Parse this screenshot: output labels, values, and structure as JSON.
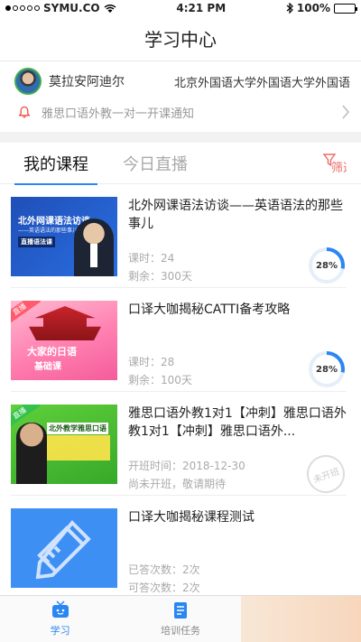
{
  "status_bar": {
    "carrier": "SYMU.CO",
    "time": "4:21 PM",
    "battery": "100%",
    "battery_level": 1.0
  },
  "nav": {
    "title": "学习中心"
  },
  "user": {
    "name": "莫拉安阿迪尔",
    "school": "北京外国语大学外国语大学外国语"
  },
  "notice": {
    "text": "雅思口语外教一对一开课通知"
  },
  "tabs": [
    {
      "label": "我的课程",
      "active": true
    },
    {
      "label": "今日直播",
      "active": false
    }
  ],
  "filter_label": "筛选",
  "courses": [
    {
      "title": "北外网课语法访谈——英语语法的那些事儿",
      "line1_label": "课时：",
      "line1_value": "24",
      "line2_label": "剩余：",
      "line2_value": "300天",
      "progress": 0.28,
      "progress_text": "28%",
      "thumb": {
        "title": "北外网课语法访谈",
        "subtitle": "——英语语法的那些事儿",
        "tag": "直播语法课"
      }
    },
    {
      "title": "口译大咖揭秘CATTI备考攻略",
      "line1_label": "课时：",
      "line1_value": "28",
      "line2_label": "剩余：",
      "line2_value": "100天",
      "progress": 0.28,
      "progress_text": "28%",
      "thumb": {
        "ribbon": "直播",
        "title": "大家的日语",
        "subtitle": "基础课"
      }
    },
    {
      "title": "雅思口语外教1对1【冲刺】雅思口语外教1对1【冲刺】雅思口语外...",
      "line1_label": "开班时间：",
      "line1_value": "2018-12-30",
      "line2_label": "",
      "line2_value": "尚未开班，敬请期待",
      "stamp": "未开班",
      "thumb": {
        "ribbon": "直播",
        "title": "北外教学雅思口语"
      }
    },
    {
      "title": "口译大咖揭秘课程测试",
      "line1_label": "已答次数：",
      "line1_value": "2次",
      "line2_label": "可答次数：",
      "line2_value": "2次"
    }
  ],
  "bottom_nav": [
    {
      "label": "学习",
      "active": true,
      "icon": "tv-icon"
    },
    {
      "label": "培训任务",
      "active": false,
      "icon": "task-icon"
    },
    {
      "label": "",
      "active": false,
      "icon": "watermark"
    }
  ],
  "colors": {
    "accent": "#2a86f2",
    "progress": "#2a86f2",
    "muted": "#aaaaaa"
  }
}
